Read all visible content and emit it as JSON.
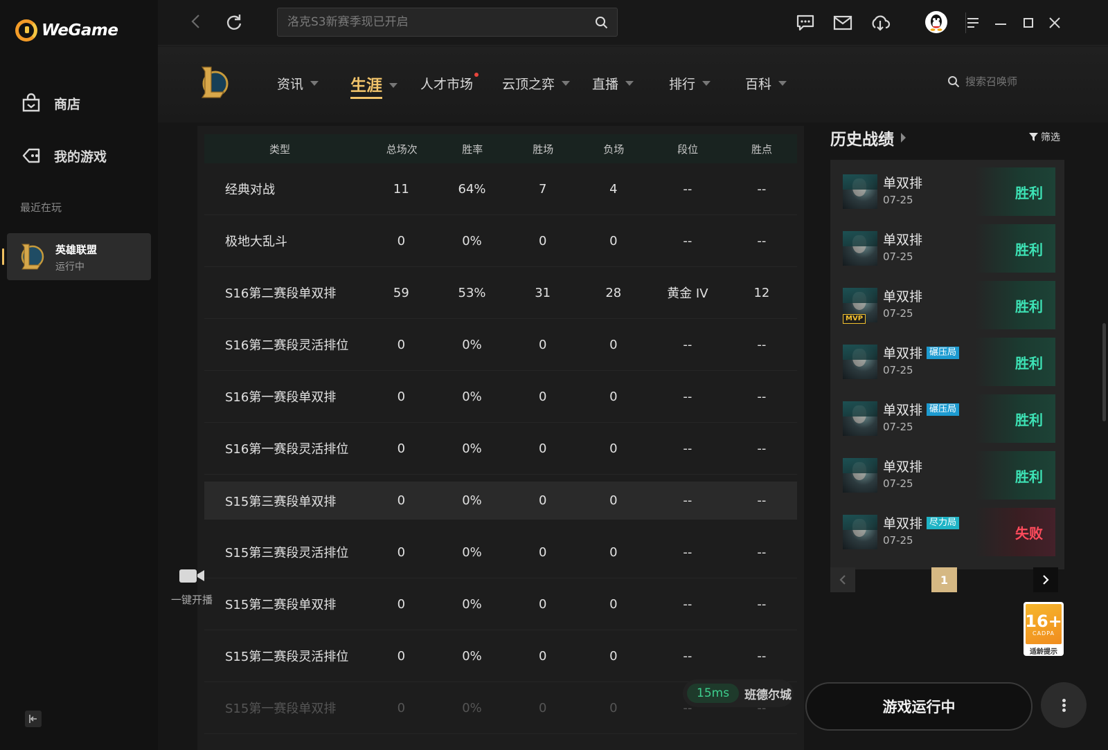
{
  "brand": {
    "name": "WeGame",
    "accent": "#f39c28"
  },
  "sidebar": {
    "items": [
      {
        "label": "商店",
        "icon": "shop-bag-icon"
      },
      {
        "label": "我的游戏",
        "icon": "gamepad-icon"
      }
    ],
    "recent_label": "最近在玩",
    "recent_game": {
      "name": "英雄联盟",
      "status": "运行中",
      "icon": "lol-logo-icon"
    }
  },
  "topbar": {
    "search_placeholder": "洛克S3新赛季现已开启",
    "icons": [
      "back-icon",
      "refresh-icon",
      "search-icon",
      "chat-icon",
      "mail-icon",
      "download-icon",
      "qq-avatar-icon",
      "menu-icon",
      "minimize-icon",
      "maximize-icon",
      "close-icon"
    ]
  },
  "game_nav": {
    "tabs": [
      {
        "label": "资讯",
        "caret": true,
        "active": false
      },
      {
        "label": "生涯",
        "caret": true,
        "active": true
      },
      {
        "label": "人才市场",
        "caret": false,
        "active": false,
        "dot": true
      },
      {
        "label": "云顶之弈",
        "caret": true,
        "active": false
      },
      {
        "label": "直播",
        "caret": true,
        "active": false
      },
      {
        "label": "排行",
        "caret": true,
        "active": false
      },
      {
        "label": "百科",
        "caret": true,
        "active": false
      }
    ],
    "summoner_search_placeholder": "搜索召唤师"
  },
  "stats_table": {
    "headers": [
      "类型",
      "总场次",
      "胜率",
      "胜场",
      "负场",
      "段位",
      "胜点"
    ],
    "rows": [
      [
        "经典对战",
        "11",
        "64%",
        "7",
        "4",
        "--",
        "--"
      ],
      [
        "极地大乱斗",
        "0",
        "0%",
        "0",
        "0",
        "--",
        "--"
      ],
      [
        "S16第二赛段单双排",
        "59",
        "53%",
        "31",
        "28",
        "黄金 IV",
        "12"
      ],
      [
        "S16第二赛段灵活排位",
        "0",
        "0%",
        "0",
        "0",
        "--",
        "--"
      ],
      [
        "S16第一赛段单双排",
        "0",
        "0%",
        "0",
        "0",
        "--",
        "--"
      ],
      [
        "S16第一赛段灵活排位",
        "0",
        "0%",
        "0",
        "0",
        "--",
        "--"
      ],
      [
        "S15第三赛段单双排",
        "0",
        "0%",
        "0",
        "0",
        "--",
        "--"
      ],
      [
        "S15第三赛段灵活排位",
        "0",
        "0%",
        "0",
        "0",
        "--",
        "--"
      ],
      [
        "S15第二赛段单双排",
        "0",
        "0%",
        "0",
        "0",
        "--",
        "--"
      ],
      [
        "S15第二赛段灵活排位",
        "0",
        "0%",
        "0",
        "0",
        "--",
        "--"
      ],
      [
        "S15第一赛段单双排",
        "0",
        "0%",
        "0",
        "0",
        "--",
        "--"
      ]
    ]
  },
  "live_button": {
    "label": "一键开播",
    "icon": "camera-icon"
  },
  "history": {
    "title": "历史战绩",
    "filter_label": "筛选",
    "matches": [
      {
        "mode": "单双排",
        "date": "07-25",
        "tag": "",
        "mvp": false,
        "result": "胜利",
        "win": true
      },
      {
        "mode": "单双排",
        "date": "07-25",
        "tag": "",
        "mvp": false,
        "result": "胜利",
        "win": true
      },
      {
        "mode": "单双排",
        "date": "07-25",
        "tag": "",
        "mvp": true,
        "mvp_label": "MVP",
        "result": "胜利",
        "win": true
      },
      {
        "mode": "单双排",
        "date": "07-25",
        "tag": "碾压局",
        "mvp": false,
        "result": "胜利",
        "win": true
      },
      {
        "mode": "单双排",
        "date": "07-25",
        "tag": "碾压局",
        "mvp": false,
        "result": "胜利",
        "win": true
      },
      {
        "mode": "单双排",
        "date": "07-25",
        "tag": "",
        "mvp": false,
        "result": "胜利",
        "win": true
      },
      {
        "mode": "单双排",
        "date": "07-25",
        "tag": "尽力局",
        "mvp": false,
        "result": "失败",
        "win": false
      }
    ],
    "pager": {
      "current": "1"
    }
  },
  "status": {
    "ping": "15ms",
    "server": "班德尔城"
  },
  "age_rating": {
    "number": "16+",
    "sub": "CADPA",
    "caption": "适龄提示"
  },
  "play_button": {
    "label": "游戏运行中"
  },
  "colors": {
    "win": "#3de2b5",
    "lose": "#ff4b5c",
    "active_tab": "#f2c46b"
  }
}
